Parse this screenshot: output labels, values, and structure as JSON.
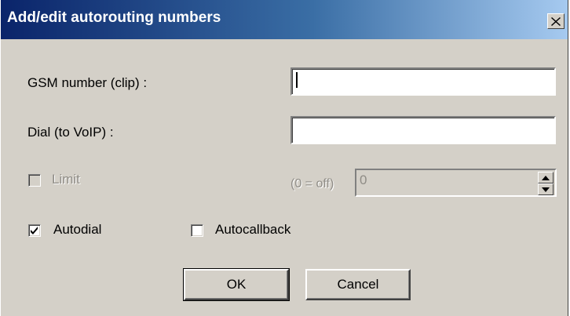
{
  "window": {
    "title": "Add/edit autorouting numbers",
    "close_symbol": "×"
  },
  "form": {
    "gsm_label": "GSM number (clip) :",
    "gsm_value": "",
    "dial_label": "Dial (to VoIP) :",
    "dial_value": "",
    "limit_label": "Limit",
    "limit_checked": false,
    "limit_hint": "(0 = off)",
    "limit_value": "0",
    "autodial_label": "Autodial",
    "autodial_checked": true,
    "autocallback_label": "Autocallback",
    "autocallback_checked": false
  },
  "buttons": {
    "ok_label": "OK",
    "cancel_label": "Cancel"
  },
  "icons": {
    "close": "close-icon",
    "check": "checkmark-icon",
    "spin_up": "triangle-up-icon",
    "spin_down": "triangle-down-icon"
  },
  "colors": {
    "titlebar_start": "#0a246a",
    "titlebar_end": "#a6caf0",
    "dialog_face": "#d4d0c8",
    "disabled_text": "#8f8c86"
  }
}
